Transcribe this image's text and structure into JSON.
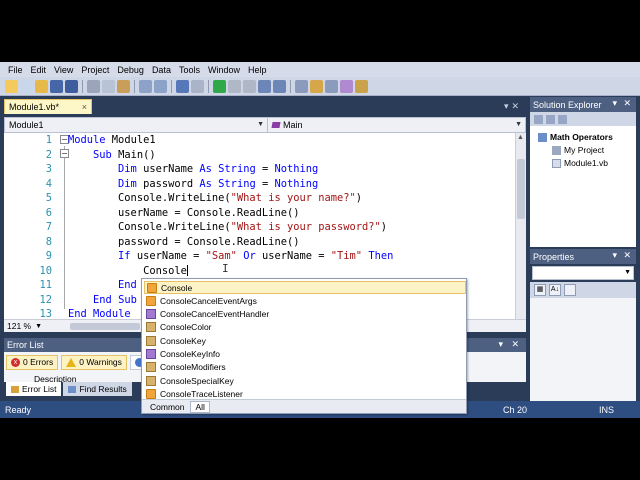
{
  "menu": [
    "File",
    "Edit",
    "View",
    "Project",
    "Debug",
    "Data",
    "Tools",
    "Window",
    "Help"
  ],
  "document_tab": {
    "label": "Module1.vb*",
    "close": "×"
  },
  "nav": {
    "left": "Module1",
    "right": "Main"
  },
  "editor": {
    "line_numbers": [
      "1",
      "2",
      "3",
      "4",
      "5",
      "6",
      "7",
      "8",
      "9",
      "10",
      "11",
      "12",
      "13"
    ],
    "lines": [
      [
        {
          "t": "Module",
          "k": "kw"
        },
        {
          "t": " Module1",
          "k": ""
        }
      ],
      [
        {
          "t": "    ",
          "k": ""
        },
        {
          "t": "Sub",
          "k": "kw"
        },
        {
          "t": " Main()",
          "k": ""
        }
      ],
      [
        {
          "t": "        ",
          "k": ""
        },
        {
          "t": "Dim",
          "k": "kw"
        },
        {
          "t": " userName ",
          "k": ""
        },
        {
          "t": "As",
          "k": "kw"
        },
        {
          "t": " ",
          "k": ""
        },
        {
          "t": "String",
          "k": "kw"
        },
        {
          "t": " = ",
          "k": ""
        },
        {
          "t": "Nothing",
          "k": "kw"
        }
      ],
      [
        {
          "t": "        ",
          "k": ""
        },
        {
          "t": "Dim",
          "k": "kw"
        },
        {
          "t": " password ",
          "k": ""
        },
        {
          "t": "As",
          "k": "kw"
        },
        {
          "t": " ",
          "k": ""
        },
        {
          "t": "String",
          "k": "kw"
        },
        {
          "t": " = ",
          "k": ""
        },
        {
          "t": "Nothing",
          "k": "kw"
        }
      ],
      [
        {
          "t": "        Console.WriteLine(",
          "k": ""
        },
        {
          "t": "\"What is your name?\"",
          "k": "str"
        },
        {
          "t": ")",
          "k": ""
        }
      ],
      [
        {
          "t": "        userName = Console.ReadLine()",
          "k": ""
        }
      ],
      [
        {
          "t": "        Console.WriteLine(",
          "k": ""
        },
        {
          "t": "\"What is your password?\"",
          "k": "str"
        },
        {
          "t": ")",
          "k": ""
        }
      ],
      [
        {
          "t": "        password = Console.ReadLine()",
          "k": ""
        }
      ],
      [
        {
          "t": "        ",
          "k": ""
        },
        {
          "t": "If",
          "k": "kw"
        },
        {
          "t": " userName = ",
          "k": ""
        },
        {
          "t": "\"Sam\"",
          "k": "str"
        },
        {
          "t": " ",
          "k": ""
        },
        {
          "t": "Or",
          "k": "kw"
        },
        {
          "t": " userName = ",
          "k": ""
        },
        {
          "t": "\"Tim\"",
          "k": "str"
        },
        {
          "t": " ",
          "k": ""
        },
        {
          "t": "Then",
          "k": "kw"
        }
      ],
      [
        {
          "t": "            Console",
          "k": ""
        }
      ],
      [
        {
          "t": "        ",
          "k": ""
        },
        {
          "t": "End",
          "k": "kw"
        }
      ],
      [
        {
          "t": "    ",
          "k": ""
        },
        {
          "t": "End",
          "k": "kw"
        },
        {
          "t": " ",
          "k": ""
        },
        {
          "t": "Sub",
          "k": "kw"
        }
      ],
      [
        {
          "t": "End",
          "k": "kw"
        },
        {
          "t": " ",
          "k": ""
        },
        {
          "t": "Module",
          "k": "kw"
        }
      ]
    ]
  },
  "zoom": "121 %",
  "intellisense": {
    "items": [
      {
        "label": "Console",
        "icon": "class",
        "selected": true
      },
      {
        "label": "ConsoleCancelEventArgs",
        "icon": "class"
      },
      {
        "label": "ConsoleCancelEventHandler",
        "icon": "delegate"
      },
      {
        "label": "ConsoleColor",
        "icon": "enum"
      },
      {
        "label": "ConsoleKey",
        "icon": "enum"
      },
      {
        "label": "ConsoleKeyInfo",
        "icon": "delegate"
      },
      {
        "label": "ConsoleModifiers",
        "icon": "enum"
      },
      {
        "label": "ConsoleSpecialKey",
        "icon": "enum"
      },
      {
        "label": "ConsoleTraceListener",
        "icon": "class"
      }
    ],
    "tabs": [
      "Common",
      "All"
    ]
  },
  "error_list": {
    "title": "Error List",
    "errors": "0 Errors",
    "warnings": "0 Warnings",
    "column": "Description"
  },
  "bottom_tabs": [
    "Error List",
    "Find Results"
  ],
  "solution_explorer": {
    "title": "Solution Explorer",
    "items": [
      "Math Operators",
      "My Project",
      "Module1.vb"
    ]
  },
  "properties": {
    "title": "Properties"
  },
  "status": {
    "left": "Ready",
    "col": "Ch 20",
    "mode": "INS"
  }
}
